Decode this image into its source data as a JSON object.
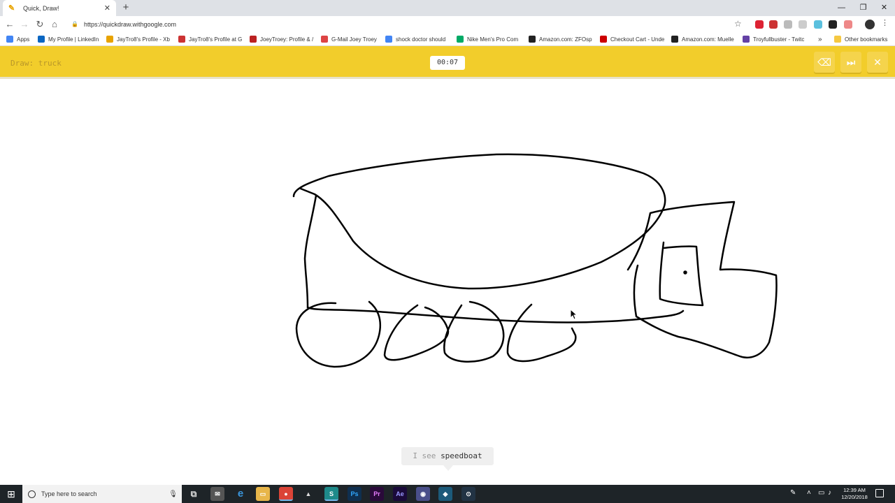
{
  "browser": {
    "tab_title": "Quick, Draw!",
    "url": "https://quickdraw.withgoogle.com",
    "bookmarks": [
      "Apps",
      "My Profile | LinkedIn",
      "JayTro8's Profile - Xb",
      "JayTro8's Profile at G",
      "JoeyTroey: Profile & /",
      "G-Mail Joey Troey",
      "shock doctor should",
      "Nike Men's Pro Com",
      "Amazon.com: ZFOsp",
      "Checkout Cart - Unde",
      "Amazon.com: Muelle",
      "Troyfullbuster - Twitc",
      "Other bookmarks"
    ]
  },
  "game": {
    "prompt": "Draw: truck",
    "timer": "00:07",
    "guess_prefix": "I see",
    "guess_word": "speedboat"
  },
  "taskbar": {
    "search_placeholder": "Type here to search",
    "time": "12:39 AM",
    "date": "12/20/2018"
  },
  "colors": {
    "header_yellow": "#f2cd2b",
    "ink": "#000000",
    "taskbar": "#1e2428"
  }
}
